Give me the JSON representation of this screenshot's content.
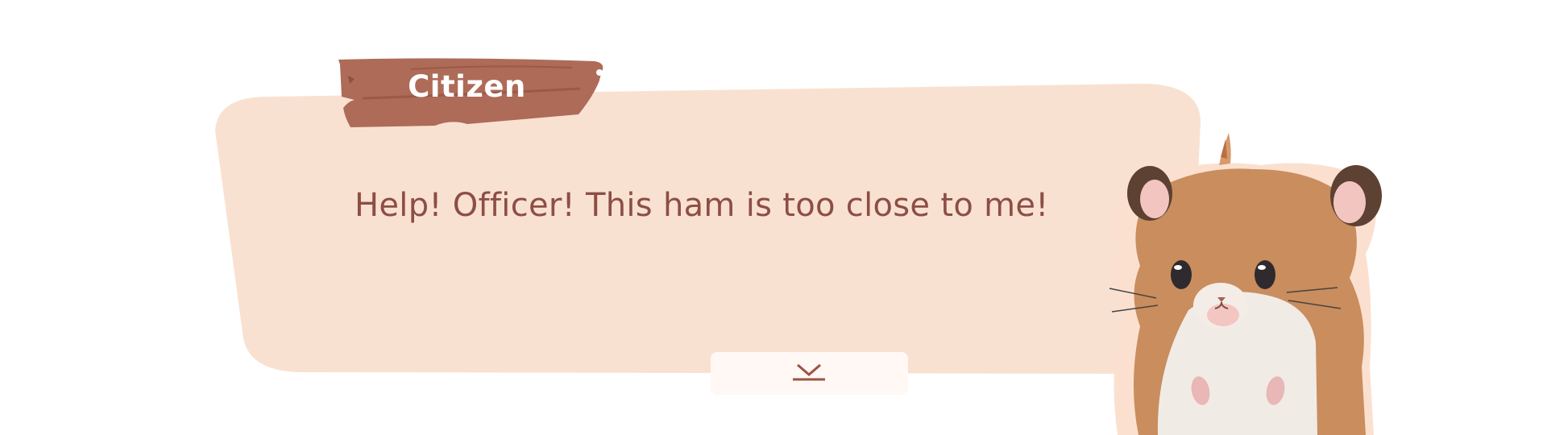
{
  "dialog": {
    "speaker": "Citizen",
    "line": "Help! Officer! This ham is too close to me!"
  },
  "controls": {
    "advance_icon": "chevron-down-bar-icon"
  },
  "character": {
    "icon": "hamster-portrait"
  },
  "colors": {
    "bubble": "#f9e1d1",
    "name_plate": "#ae6b58",
    "text": "#8c4e45",
    "next_button": "#fff8f4"
  }
}
